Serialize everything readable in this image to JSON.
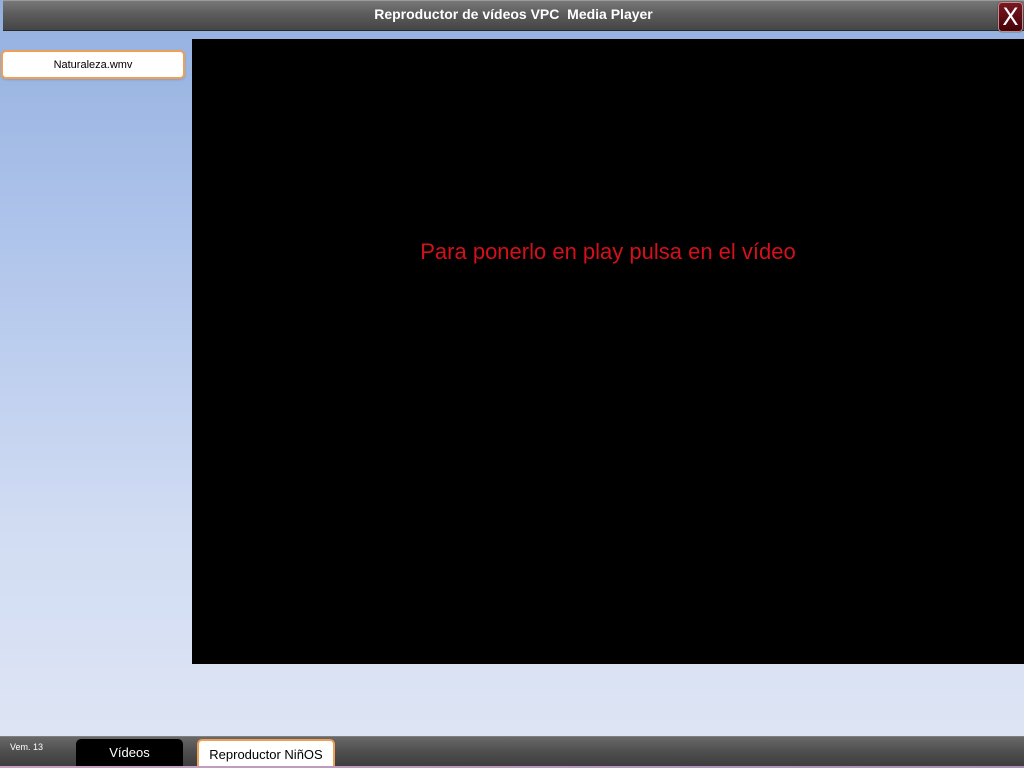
{
  "window": {
    "title": "Reproductor de vídeos VPC  Media Player",
    "close_label": "X"
  },
  "playlist": {
    "items": [
      {
        "label": "Naturaleza.wmv"
      }
    ]
  },
  "video": {
    "hint": "Para ponerlo en play pulsa en el vídeo"
  },
  "taskbar": {
    "version": "Vem. 13",
    "buttons": [
      {
        "label": "Vídeos"
      },
      {
        "label": "Reproductor NiñOS"
      }
    ]
  },
  "colors": {
    "hint_text": "#d4101c",
    "accent_border": "#f0a054",
    "close_button": "#5a0a12",
    "video_background": "#000000"
  }
}
